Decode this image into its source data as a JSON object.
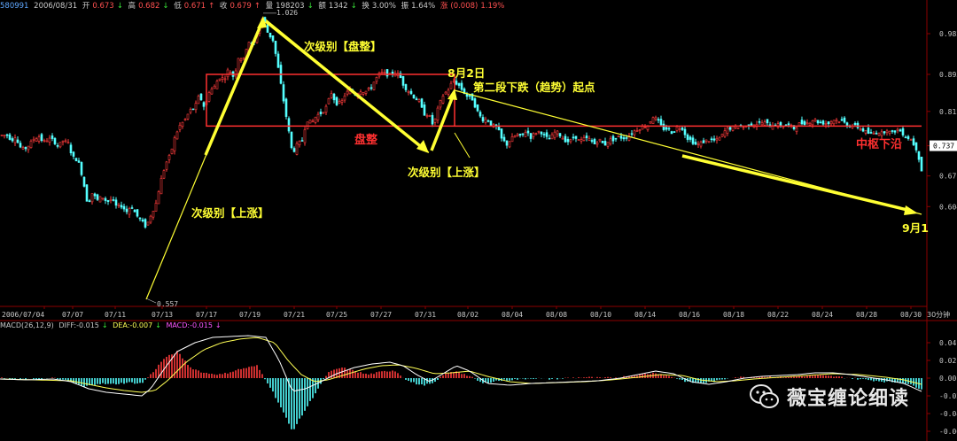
{
  "header": {
    "code": "580991",
    "date": "2006/08/31",
    "open_label": "开",
    "open": "0.673",
    "high_label": "高",
    "high": "0.682",
    "low_label": "低",
    "low": "0.671",
    "close_label": "收",
    "close": "0.679",
    "volume_label": "量",
    "volume": "198203",
    "amount_label": "额",
    "amount": "1342",
    "turnover_label": "换",
    "turnover": "3.00%",
    "amplitude_label": "振",
    "amplitude": "1.64%",
    "change_label": "涨",
    "change": "(0.008)",
    "change_pct": "1.19%"
  },
  "macd_header": {
    "name": "MACD(26,12,9)",
    "diff": "DIFF:-0.015",
    "dea": "DEA:-0.007",
    "macd": "MACD:-0.015"
  },
  "colors": {
    "up": "#ff3b3b",
    "down": "#54ffff",
    "annotation_yellow": "#ffff33",
    "box_red": "#ff3030",
    "background": "#000000",
    "axis": "#8b0000"
  },
  "chart_data": {
    "type": "candlestick",
    "timeframe": "30分钟",
    "ylim": [
      0.557,
      1.026
    ],
    "y_ticks": [
      0.604,
      0.671,
      0.737,
      0.812,
      0.893,
      0.982
    ],
    "current_price_label": "0.737",
    "x_ticks": [
      "2006/07/04",
      "07/07",
      "07/11",
      "07/13",
      "07/17",
      "07/19",
      "07/21",
      "07/25",
      "07/27",
      "07/31",
      "08/02",
      "08/04",
      "08/08",
      "08/10",
      "08/14",
      "08/16",
      "08/18",
      "08/22",
      "08/24",
      "08/28",
      "08/30"
    ],
    "price_path": [
      [
        0,
        0.76
      ],
      [
        9,
        0.76
      ],
      [
        13,
        0.748
      ],
      [
        17,
        0.758
      ],
      [
        22,
        0.735
      ],
      [
        27,
        0.728
      ],
      [
        33,
        0.739
      ],
      [
        38,
        0.752
      ],
      [
        44,
        0.757
      ],
      [
        49,
        0.745
      ],
      [
        55,
        0.752
      ],
      [
        60,
        0.749
      ],
      [
        66,
        0.736
      ],
      [
        71,
        0.748
      ],
      [
        77,
        0.742
      ],
      [
        82,
        0.712
      ],
      [
        88,
        0.705
      ],
      [
        93,
        0.67
      ],
      [
        99,
        0.608
      ],
      [
        104,
        0.633
      ],
      [
        110,
        0.618
      ],
      [
        115,
        0.626
      ],
      [
        121,
        0.614
      ],
      [
        126,
        0.621
      ],
      [
        132,
        0.602
      ],
      [
        137,
        0.606
      ],
      [
        143,
        0.593
      ],
      [
        148,
        0.606
      ],
      [
        154,
        0.585
      ],
      [
        159,
        0.574
      ],
      [
        165,
        0.559
      ],
      [
        170,
        0.585
      ],
      [
        176,
        0.611
      ],
      [
        181,
        0.657
      ],
      [
        187,
        0.698
      ],
      [
        192,
        0.716
      ],
      [
        198,
        0.76
      ],
      [
        203,
        0.781
      ],
      [
        209,
        0.794
      ],
      [
        214,
        0.813
      ],
      [
        220,
        0.821
      ],
      [
        225,
        0.848
      ],
      [
        231,
        0.819
      ],
      [
        236,
        0.856
      ],
      [
        242,
        0.866
      ],
      [
        247,
        0.887
      ],
      [
        253,
        0.883
      ],
      [
        258,
        0.905
      ],
      [
        264,
        0.886
      ],
      [
        269,
        0.93
      ],
      [
        275,
        0.926
      ],
      [
        280,
        0.967
      ],
      [
        286,
        0.954
      ],
      [
        291,
        0.991
      ],
      [
        297,
        1.019
      ],
      [
        302,
        0.985
      ],
      [
        308,
        0.968
      ],
      [
        313,
        0.918
      ],
      [
        319,
        0.847
      ],
      [
        324,
        0.79
      ],
      [
        330,
        0.72
      ],
      [
        335,
        0.738
      ],
      [
        341,
        0.749
      ],
      [
        346,
        0.794
      ],
      [
        352,
        0.787
      ],
      [
        357,
        0.803
      ],
      [
        363,
        0.809
      ],
      [
        368,
        0.821
      ],
      [
        374,
        0.853
      ],
      [
        379,
        0.83
      ],
      [
        385,
        0.83
      ],
      [
        390,
        0.852
      ],
      [
        396,
        0.858
      ],
      [
        401,
        0.849
      ],
      [
        407,
        0.858
      ],
      [
        412,
        0.855
      ],
      [
        418,
        0.861
      ],
      [
        423,
        0.88
      ],
      [
        429,
        0.896
      ],
      [
        434,
        0.895
      ],
      [
        440,
        0.891
      ],
      [
        445,
        0.899
      ],
      [
        451,
        0.89
      ],
      [
        456,
        0.867
      ],
      [
        462,
        0.855
      ],
      [
        467,
        0.844
      ],
      [
        473,
        0.834
      ],
      [
        478,
        0.807
      ],
      [
        484,
        0.805
      ],
      [
        489,
        0.78
      ],
      [
        495,
        0.823
      ],
      [
        500,
        0.847
      ],
      [
        506,
        0.86
      ],
      [
        511,
        0.879
      ],
      [
        517,
        0.871
      ],
      [
        522,
        0.858
      ],
      [
        528,
        0.843
      ],
      [
        533,
        0.839
      ],
      [
        539,
        0.811
      ],
      [
        544,
        0.794
      ],
      [
        550,
        0.795
      ],
      [
        555,
        0.78
      ],
      [
        561,
        0.778
      ],
      [
        566,
        0.752
      ],
      [
        572,
        0.74
      ],
      [
        577,
        0.752
      ],
      [
        583,
        0.761
      ],
      [
        588,
        0.755
      ],
      [
        594,
        0.771
      ],
      [
        599,
        0.756
      ],
      [
        605,
        0.766
      ],
      [
        610,
        0.769
      ],
      [
        616,
        0.754
      ],
      [
        621,
        0.752
      ],
      [
        627,
        0.769
      ],
      [
        632,
        0.76
      ],
      [
        638,
        0.749
      ],
      [
        643,
        0.745
      ],
      [
        649,
        0.759
      ],
      [
        654,
        0.746
      ],
      [
        660,
        0.753
      ],
      [
        665,
        0.751
      ],
      [
        671,
        0.741
      ],
      [
        676,
        0.751
      ],
      [
        682,
        0.738
      ],
      [
        687,
        0.749
      ],
      [
        693,
        0.751
      ],
      [
        698,
        0.756
      ],
      [
        704,
        0.754
      ],
      [
        709,
        0.758
      ],
      [
        715,
        0.768
      ],
      [
        720,
        0.774
      ],
      [
        726,
        0.779
      ],
      [
        731,
        0.782
      ],
      [
        737,
        0.801
      ],
      [
        742,
        0.792
      ],
      [
        748,
        0.774
      ],
      [
        753,
        0.774
      ],
      [
        759,
        0.765
      ],
      [
        764,
        0.777
      ],
      [
        770,
        0.776
      ],
      [
        775,
        0.755
      ],
      [
        781,
        0.747
      ],
      [
        786,
        0.738
      ],
      [
        792,
        0.744
      ],
      [
        797,
        0.748
      ],
      [
        803,
        0.749
      ],
      [
        808,
        0.748
      ],
      [
        814,
        0.757
      ],
      [
        819,
        0.772
      ],
      [
        825,
        0.776
      ],
      [
        830,
        0.778
      ],
      [
        836,
        0.779
      ],
      [
        841,
        0.778
      ],
      [
        847,
        0.785
      ],
      [
        852,
        0.785
      ],
      [
        858,
        0.787
      ],
      [
        863,
        0.787
      ],
      [
        869,
        0.781
      ],
      [
        874,
        0.785
      ],
      [
        880,
        0.78
      ],
      [
        885,
        0.782
      ],
      [
        891,
        0.781
      ],
      [
        896,
        0.775
      ],
      [
        902,
        0.785
      ],
      [
        907,
        0.787
      ],
      [
        913,
        0.788
      ],
      [
        918,
        0.795
      ],
      [
        924,
        0.788
      ],
      [
        929,
        0.787
      ],
      [
        935,
        0.786
      ],
      [
        940,
        0.794
      ],
      [
        946,
        0.793
      ],
      [
        951,
        0.79
      ],
      [
        957,
        0.781
      ],
      [
        962,
        0.781
      ],
      [
        968,
        0.778
      ],
      [
        973,
        0.772
      ],
      [
        979,
        0.765
      ],
      [
        984,
        0.762
      ],
      [
        990,
        0.768
      ],
      [
        995,
        0.764
      ],
      [
        1001,
        0.773
      ],
      [
        1006,
        0.763
      ],
      [
        1012,
        0.773
      ],
      [
        1017,
        0.768
      ],
      [
        1023,
        0.756
      ],
      [
        1028,
        0.751
      ],
      [
        1034,
        0.731
      ],
      [
        1036,
        0.719
      ],
      [
        1040,
        0.683
      ]
    ],
    "high_label": "1.026",
    "low_label": "0.557",
    "consolidation_box": {
      "top_price": 0.893,
      "bottom_price": 0.78,
      "label": "盘整"
    },
    "pivot_lower_line": {
      "price": 0.78,
      "label": "中枢下沿"
    },
    "annotations": {
      "sub_up_1": "次级别【上涨】",
      "sub_consolidation": "次级别【盘整】",
      "sub_up_2": "次级别【上涨】",
      "aug2": "8月2日",
      "second_leg": "第二段下跌（趋势）起点",
      "sep1": "9月1"
    },
    "macd": {
      "ylim": [
        -0.06,
        0.06
      ],
      "y_ticks": [
        0.04,
        0.02,
        0.0,
        -0.02,
        -0.04,
        -0.06
      ],
      "hist_path": [
        [
          0,
          0.0
        ],
        [
          15,
          -0.001
        ],
        [
          40,
          -0.001
        ],
        [
          60,
          0.0
        ],
        [
          80,
          -0.004
        ],
        [
          95,
          -0.01
        ],
        [
          110,
          -0.006
        ],
        [
          125,
          -0.007
        ],
        [
          145,
          -0.005
        ],
        [
          160,
          -0.006
        ],
        [
          172,
          0.006
        ],
        [
          185,
          0.022
        ],
        [
          200,
          0.03
        ],
        [
          215,
          0.012
        ],
        [
          230,
          0.006
        ],
        [
          250,
          0.004
        ],
        [
          270,
          0.01
        ],
        [
          290,
          0.014
        ],
        [
          305,
          -0.01
        ],
        [
          318,
          -0.035
        ],
        [
          330,
          -0.06
        ],
        [
          345,
          -0.035
        ],
        [
          360,
          -0.01
        ],
        [
          370,
          0.006
        ],
        [
          385,
          0.012
        ],
        [
          400,
          0.008
        ],
        [
          415,
          0.004
        ],
        [
          430,
          0.007
        ],
        [
          445,
          0.009
        ],
        [
          460,
          -0.003
        ],
        [
          475,
          -0.008
        ],
        [
          490,
          -0.006
        ],
        [
          500,
          0.004
        ],
        [
          515,
          0.008
        ],
        [
          530,
          0.002
        ],
        [
          545,
          -0.006
        ],
        [
          560,
          -0.003
        ],
        [
          575,
          -0.002
        ],
        [
          600,
          0.0
        ],
        [
          620,
          -0.001
        ],
        [
          640,
          0.0
        ],
        [
          660,
          0.001
        ],
        [
          680,
          0.0
        ],
        [
          700,
          0.001
        ],
        [
          720,
          0.004
        ],
        [
          740,
          0.006
        ],
        [
          760,
          0.001
        ],
        [
          775,
          -0.004
        ],
        [
          790,
          -0.006
        ],
        [
          810,
          -0.003
        ],
        [
          825,
          0.001
        ],
        [
          840,
          0.001
        ],
        [
          860,
          0.002
        ],
        [
          880,
          0.001
        ],
        [
          900,
          0.002
        ],
        [
          920,
          0.003
        ],
        [
          940,
          0.002
        ],
        [
          960,
          0.0
        ],
        [
          980,
          -0.002
        ],
        [
          1000,
          -0.004
        ],
        [
          1020,
          -0.005
        ],
        [
          1040,
          -0.012
        ]
      ],
      "diff_path": [
        [
          0,
          -0.001
        ],
        [
          30,
          -0.002
        ],
        [
          60,
          -0.001
        ],
        [
          80,
          -0.004
        ],
        [
          100,
          -0.012
        ],
        [
          120,
          -0.016
        ],
        [
          140,
          -0.018
        ],
        [
          160,
          -0.02
        ],
        [
          170,
          -0.012
        ],
        [
          185,
          0.01
        ],
        [
          200,
          0.03
        ],
        [
          220,
          0.04
        ],
        [
          240,
          0.046
        ],
        [
          260,
          0.047
        ],
        [
          280,
          0.048
        ],
        [
          300,
          0.046
        ],
        [
          315,
          0.02
        ],
        [
          330,
          -0.015
        ],
        [
          345,
          -0.012
        ],
        [
          360,
          -0.005
        ],
        [
          380,
          0.005
        ],
        [
          400,
          0.012
        ],
        [
          420,
          0.016
        ],
        [
          440,
          0.018
        ],
        [
          455,
          0.014
        ],
        [
          470,
          0.004
        ],
        [
          485,
          -0.004
        ],
        [
          500,
          0.005
        ],
        [
          515,
          0.014
        ],
        [
          530,
          0.008
        ],
        [
          550,
          -0.006
        ],
        [
          575,
          -0.008
        ],
        [
          600,
          -0.006
        ],
        [
          625,
          -0.005
        ],
        [
          650,
          -0.004
        ],
        [
          675,
          -0.003
        ],
        [
          700,
          0.0
        ],
        [
          720,
          0.004
        ],
        [
          740,
          0.008
        ],
        [
          760,
          0.005
        ],
        [
          780,
          -0.004
        ],
        [
          800,
          -0.007
        ],
        [
          820,
          -0.004
        ],
        [
          840,
          0.0
        ],
        [
          860,
          0.002
        ],
        [
          880,
          0.003
        ],
        [
          900,
          0.004
        ],
        [
          920,
          0.006
        ],
        [
          940,
          0.006
        ],
        [
          960,
          0.004
        ],
        [
          980,
          0.001
        ],
        [
          1000,
          -0.002
        ],
        [
          1020,
          -0.006
        ],
        [
          1040,
          -0.015
        ]
      ],
      "dea_path": [
        [
          0,
          -0.001
        ],
        [
          40,
          -0.002
        ],
        [
          80,
          -0.003
        ],
        [
          100,
          -0.007
        ],
        [
          120,
          -0.011
        ],
        [
          140,
          -0.014
        ],
        [
          160,
          -0.016
        ],
        [
          175,
          -0.014
        ],
        [
          190,
          -0.002
        ],
        [
          210,
          0.018
        ],
        [
          230,
          0.032
        ],
        [
          250,
          0.04
        ],
        [
          270,
          0.044
        ],
        [
          290,
          0.046
        ],
        [
          310,
          0.04
        ],
        [
          325,
          0.02
        ],
        [
          340,
          0.004
        ],
        [
          355,
          -0.004
        ],
        [
          370,
          -0.002
        ],
        [
          390,
          0.004
        ],
        [
          410,
          0.01
        ],
        [
          430,
          0.014
        ],
        [
          450,
          0.015
        ],
        [
          470,
          0.011
        ],
        [
          490,
          0.005
        ],
        [
          510,
          0.006
        ],
        [
          530,
          0.008
        ],
        [
          550,
          0.002
        ],
        [
          575,
          -0.004
        ],
        [
          600,
          -0.006
        ],
        [
          630,
          -0.005
        ],
        [
          660,
          -0.004
        ],
        [
          690,
          -0.002
        ],
        [
          720,
          0.001
        ],
        [
          745,
          0.004
        ],
        [
          770,
          0.003
        ],
        [
          790,
          -0.002
        ],
        [
          810,
          -0.004
        ],
        [
          830,
          -0.003
        ],
        [
          850,
          -0.001
        ],
        [
          880,
          0.001
        ],
        [
          910,
          0.003
        ],
        [
          940,
          0.005
        ],
        [
          970,
          0.004
        ],
        [
          1000,
          0.001
        ],
        [
          1020,
          -0.002
        ],
        [
          1040,
          -0.007
        ]
      ]
    }
  },
  "watermark": {
    "text": "薇宝缠论细读"
  }
}
